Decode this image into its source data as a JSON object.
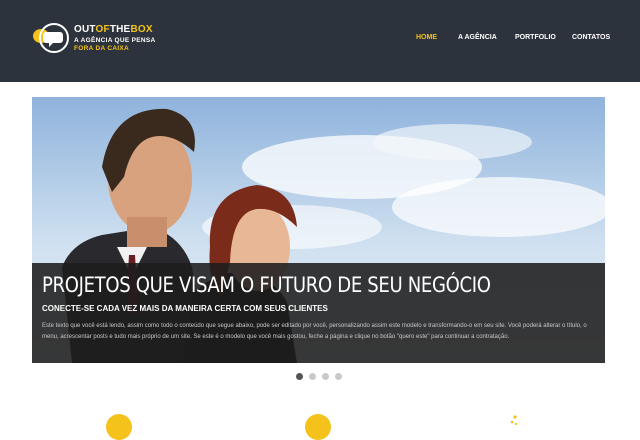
{
  "brand": {
    "name_part1": "OUT",
    "name_part2": "OF",
    "name_part3": "THE",
    "name_part4": "BOX",
    "tagline_line1": "A AGÊNCIA QUE PENSA",
    "tagline_line2": "FORA DA CAIXA",
    "icon": "speech-bubble-logo-icon"
  },
  "nav": {
    "items": [
      {
        "label": "HOME",
        "active": true
      },
      {
        "label": "A AGÊNCIA",
        "active": false
      },
      {
        "label": "PORTFOLIO",
        "active": false
      },
      {
        "label": "CONTATOS",
        "active": false
      }
    ]
  },
  "slider": {
    "image": "couple-looking-at-sky-photo",
    "title": "PROJETOS QUE VISAM O FUTURO DE SEU NEGÓCIO",
    "subtitle": "CONECTE-SE CADA VEZ MAIS DA MANEIRA CERTA COM SEUS CLIENTES",
    "body": "Este texto que você está lendo, assim como todo o conteúdo que segue abaixo, pode ser editado por você, personalizando assim este modelo e transformando-o em seu site. Você poderá alterar o título, o menu, acrescentar posts e tudo mais próprio de um site. Se este é o modelo que você mais gostou, feche a página e clique no botão \"quero este\" para continuar a contratação.",
    "dots": [
      true,
      false,
      false,
      false
    ]
  },
  "features": {
    "icons": [
      "feature-1-icon",
      "feature-2-icon",
      "feature-3-icon"
    ]
  },
  "colors": {
    "header_bg": "#2d333c",
    "accent": "#f4c21a",
    "caption_bg": "#1c1c1c"
  }
}
